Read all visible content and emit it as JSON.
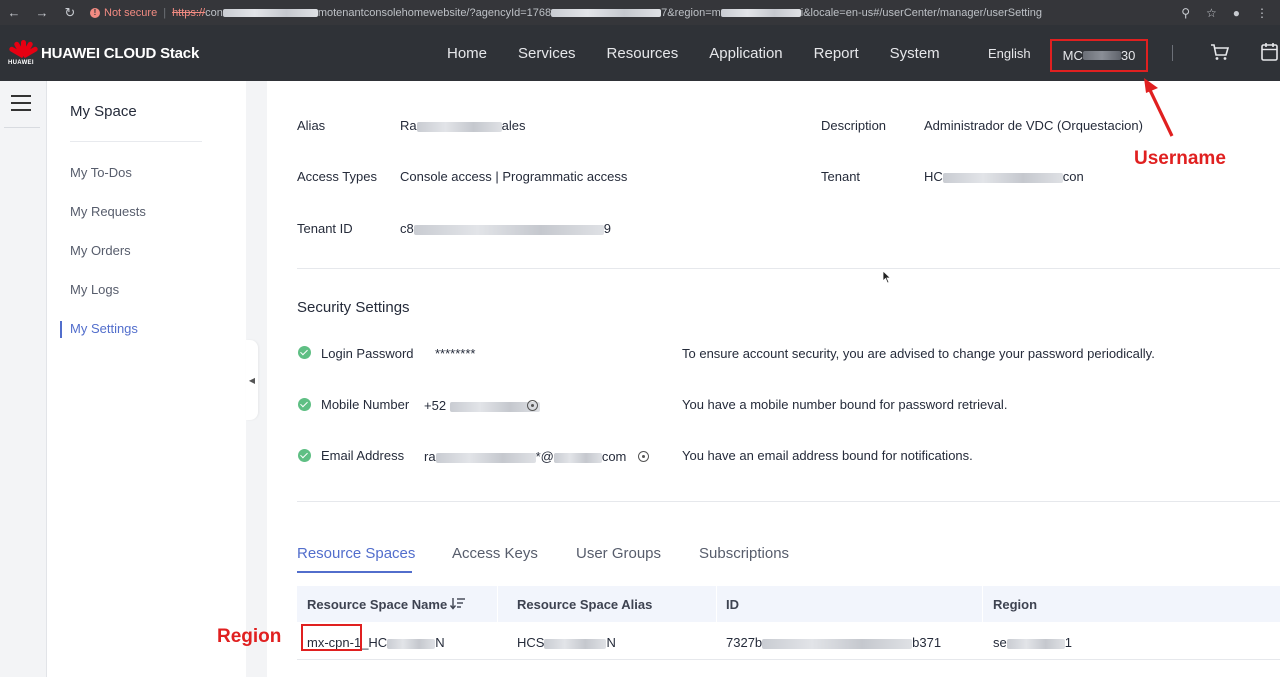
{
  "browser": {
    "not_secure": "Not secure",
    "url_scheme": "https://",
    "url_host": "con",
    "url_path": "motenantconsolehomewebsite/?agencyId=1768",
    "url_query": "7&region=m",
    "url_tail": "i&locale=en-us#/userCenter/manager/userSetting"
  },
  "header": {
    "brand_small": "HUAWEI",
    "brand": "HUAWEI CLOUD Stack",
    "nav": [
      "Home",
      "Services",
      "Resources",
      "Application",
      "Report",
      "System"
    ],
    "language": "English",
    "username_prefix": "MC",
    "username_suffix": "30"
  },
  "side_menu": {
    "title": "My Space",
    "items": [
      "My To-Dos",
      "My Requests",
      "My Orders",
      "My Logs",
      "My Settings"
    ],
    "active": "My Settings"
  },
  "account": {
    "alias_label": "Alias",
    "alias_prefix": "Ra",
    "alias_suffix": "ales",
    "description_label": "Description",
    "description_value": "Administrador de VDC (Orquestacion)",
    "access_types_label": "Access Types",
    "access_types_value": "Console access | Programmatic access",
    "tenant_label": "Tenant",
    "tenant_prefix": "HC",
    "tenant_suffix": "con",
    "tenant_id_label": "Tenant ID",
    "tenant_id_prefix": "c8",
    "tenant_id_suffix": "9"
  },
  "security": {
    "title": "Security Settings",
    "rows": [
      {
        "label": "Login Password",
        "value": "********",
        "note": "To ensure account security, you are advised to change your password periodically."
      },
      {
        "label": "Mobile Number",
        "value_prefix": "+52",
        "note": "You have a mobile number bound for password retrieval."
      },
      {
        "label": "Email Address",
        "value_prefix": "ra",
        "value_suffix": "*@",
        "value_end": "com",
        "note": "You have an email address bound for notifications."
      }
    ]
  },
  "tabs": [
    "Resource Spaces",
    "Access Keys",
    "User Groups",
    "Subscriptions"
  ],
  "active_tab": "Resource Spaces",
  "table": {
    "columns": [
      "Resource Space Name",
      "Resource Space Alias",
      "ID",
      "Region"
    ],
    "row": {
      "name_prefix": "mx-cpn-1",
      "name_mid": "_HC",
      "name_end": "N",
      "alias_prefix": "HCS",
      "alias_end": "N",
      "id_prefix": "7327b",
      "id_end": "b371",
      "region_prefix": "se",
      "region_end": "1"
    }
  },
  "annotations": {
    "username": "Username",
    "region": "Region"
  },
  "colors": {
    "accent": "#526ecc",
    "annotation": "#e02020",
    "header_bg": "#2f3237",
    "success": "#5fbf84"
  }
}
